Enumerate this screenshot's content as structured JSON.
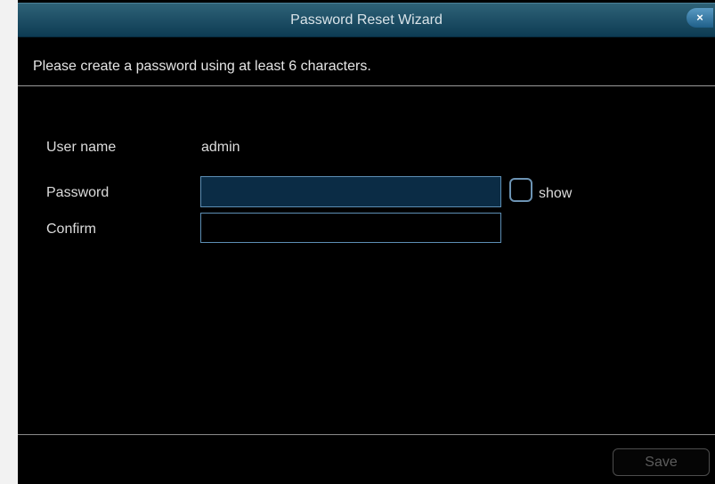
{
  "dialog": {
    "title": "Password Reset Wizard",
    "close_icon": "close-icon",
    "close_glyph": "×",
    "instruction": "Please create a password using at least 6 characters."
  },
  "form": {
    "username_label": "User name",
    "username_value": "admin",
    "password_label": "Password",
    "password_value": "",
    "confirm_label": "Confirm",
    "confirm_value": "",
    "show_label": "show",
    "show_checked": false
  },
  "footer": {
    "save_label": "Save",
    "save_enabled": false
  },
  "colors": {
    "title_bar_top": "#2e6277",
    "title_bar_bottom": "#0d3b53",
    "field_border": "#5d8fb5",
    "password_field_bg": "#0b2c45",
    "confirm_field_bg": "#000000",
    "close_button": "#3d80ad"
  }
}
